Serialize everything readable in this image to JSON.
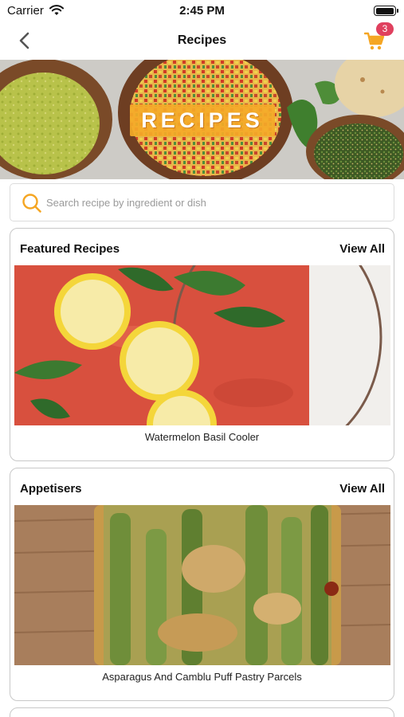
{
  "status_bar": {
    "carrier": "Carrier",
    "time": "2:45 PM"
  },
  "nav": {
    "title": "Recipes",
    "cart_count": "3"
  },
  "hero": {
    "title": "RECIPES"
  },
  "search": {
    "placeholder": "Search recipe by ingredient or dish"
  },
  "sections": [
    {
      "title": "Featured Recipes",
      "view_all": "View All",
      "caption": "Watermelon Basil Cooler"
    },
    {
      "title": "Appetisers",
      "view_all": "View All",
      "caption": "Asparagus And Camblu Puff Pastry Parcels"
    }
  ],
  "colors": {
    "accent": "#f5a623",
    "badge": "#e0405e"
  }
}
